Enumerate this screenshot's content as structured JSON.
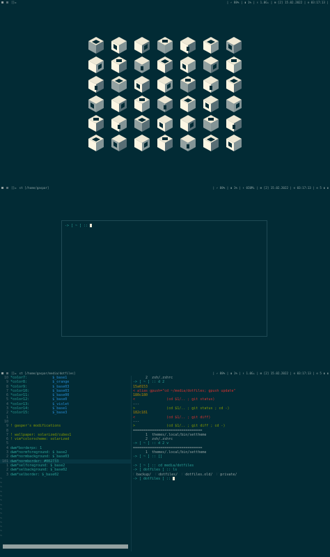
{
  "colors": {
    "bg": "#022b35",
    "accent": "#2aa198",
    "green": "#859900",
    "red": "#dc322f",
    "yellow": "#b58900",
    "blue": "#268bd2"
  },
  "bar1": {
    "layout": "[]=",
    "title": "",
    "status": "| ⚡ 88% | ▮ 1% | ⬇ 1.0G↓ | ⊞ [2] 15.02.2022 | ⊙ 03:17:13 |"
  },
  "bar2": {
    "layout": "[]=",
    "title": "st [/home/gaspar]",
    "status": "| ⚡ 88% | ▮ 1% | ⬇ 0I0M↓ | ⊞ [2] 15.02.2022 | ⊙ 03:17:13 | ⊙ 5 ▮ ▮"
  },
  "bar3": {
    "layout": "[]=",
    "title": "st [/home/gaspar/media/dotfiles]",
    "status": "| ⚡ 88% | ▮ 1% | ⬇ 1.0G↓ | ⊞ [2] 15.02.2022 | ⊙ 03:17:13 | ⊙ 5 ▮ ▮"
  },
  "float_prompt": "-> [ ~ ] :: ",
  "vim_lines": [
    {
      "n": "10",
      "k": "*color7:",
      "v": "$_base1"
    },
    {
      "n": "9",
      "k": "*color8:",
      "v": "$_orange"
    },
    {
      "n": "8",
      "k": "*color9:",
      "v": "$_base03"
    },
    {
      "n": "7",
      "k": "*color10:",
      "v": "$_base03"
    },
    {
      "n": "6",
      "k": "*color11:",
      "v": "$_base00"
    },
    {
      "n": "5",
      "k": "*color12:",
      "v": "$_base0"
    },
    {
      "n": "4",
      "k": "*color13:",
      "v": "$_violet"
    },
    {
      "n": "3",
      "k": "*color14:",
      "v": "$_base1"
    },
    {
      "n": "2",
      "k": "*color15:",
      "v": "$_base3"
    },
    {
      "n": "1",
      "k": "",
      "v": ""
    },
    {
      "n": "10",
      "k": "",
      "v": ""
    },
    {
      "n": "9",
      "k": "! gasper's modifications",
      "v": ""
    },
    {
      "n": "8",
      "k": "",
      "v": ""
    },
    {
      "n": "7",
      "k": "! wallpaper: solarized/cubes1",
      "v": ""
    },
    {
      "n": "6",
      "k": "! vim*colorscheme: solarized",
      "v": ""
    },
    {
      "n": "5",
      "k": "",
      "v": ""
    },
    {
      "n": "4",
      "k": "dwm*borderpx: 1",
      "v": ""
    },
    {
      "n": "3",
      "k": "dwm*normforeground: $_base2",
      "v": ""
    },
    {
      "n": "2",
      "k": "dwm*normbackground: $_base03",
      "v": ""
    },
    {
      "n": "101",
      "k": "dwm*normborder: #002733",
      "v": ""
    },
    {
      "n": "1",
      "k": "dwm*selforeground: $_base2",
      "v": ""
    },
    {
      "n": "2",
      "k": "dwm*selbackground: $_base02",
      "v": ""
    },
    {
      "n": "3",
      "k": "dwm*selborder: $_base02",
      "v": ""
    }
  ],
  "term_lines": [
    "      2  zsh/.zshrc",
    "-> [ ~ ] :: d 2",
    "15a0153",
    "< alias gpush=\"cd ~/media/dotfiles; gpush update\"",
    "180c180",
    "<               (cd $1/.. ; git status)",
    "---",
    ">               (cd $1/.. ; git status ; cd -)",
    "182c181",
    "<               (cd $1/.. ; git diff)",
    "---",
    ">               (cd $1/.. ; git diff ; cd -)",
    "=================================",
    "      1  themes/.local/bin/settheme",
    "      2  zsh/.zshrc",
    "-> [ ~ ] :: d 2 v",
    "=================================",
    "      1  themes/.local/bin/settheme",
    "-> [ ~ ] :: []",
    "",
    "-> [ ~ ] :: cd media/dotfiles",
    "-> [ dotfiles ] :: ls",
    "🗀backup/  🗀dotfiles/  🗀dotfiles.old/  🗀private/",
    "-> [ dotfiles ] :: "
  ]
}
